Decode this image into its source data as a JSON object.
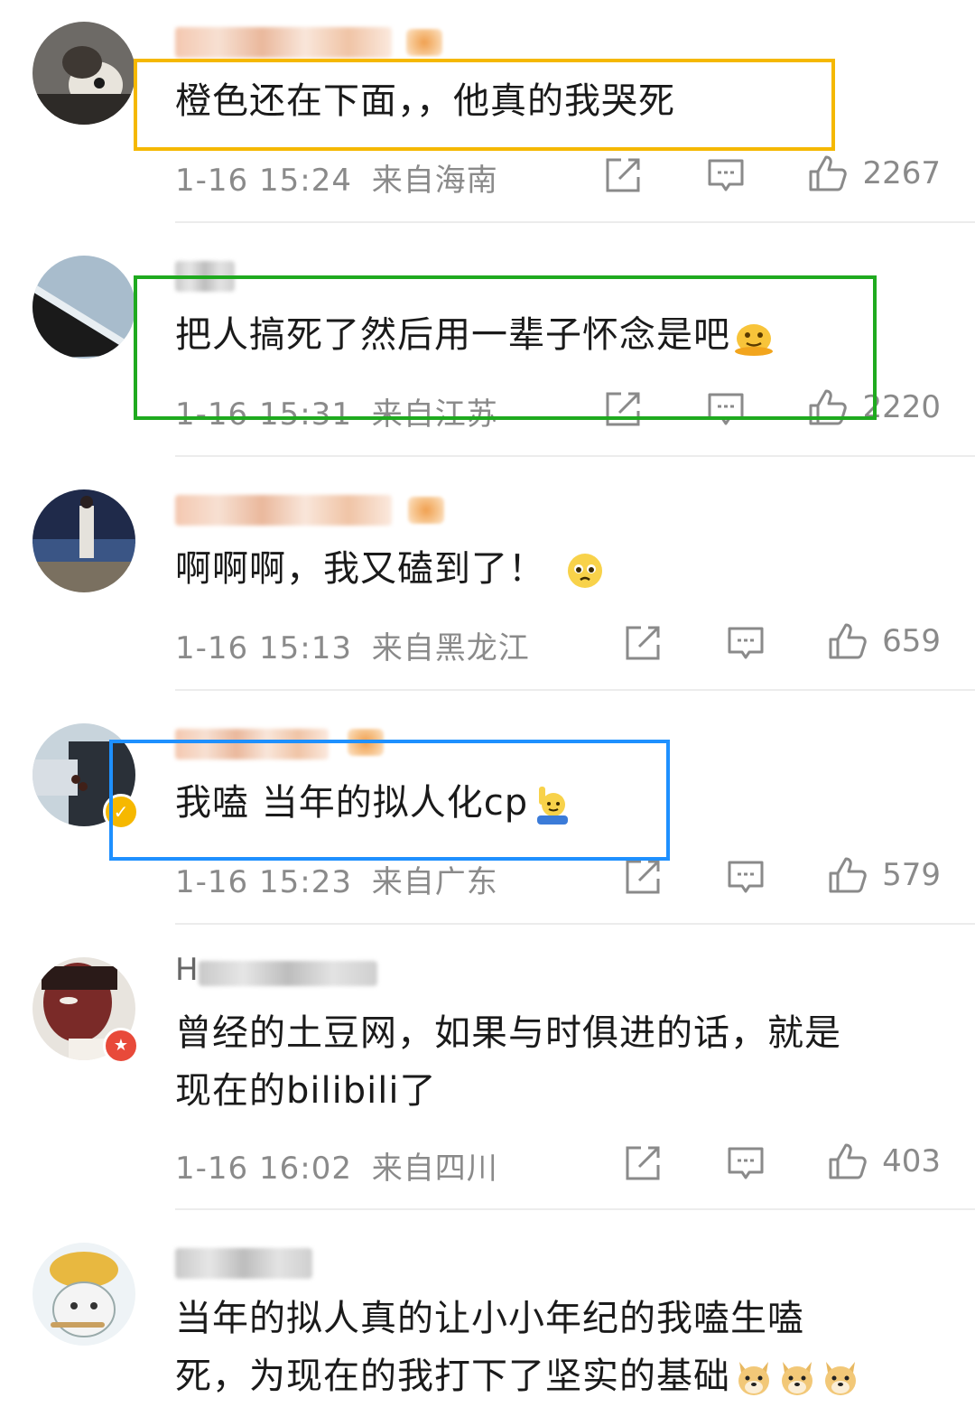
{
  "colors": {
    "highlight_orange": "#f5b800",
    "highlight_green": "#1faa1f",
    "highlight_blue": "#1e90ff",
    "meta_grey": "#8a8a8a"
  },
  "comments": [
    {
      "text_lines": [
        "橙色还在下面，，他真的我哭死"
      ],
      "time": "1-16 15:24",
      "location": "来自海南",
      "likes": "2267",
      "emojis": []
    },
    {
      "text_lines": [
        "把人搞死了然后用一辈子怀念是吧"
      ],
      "time": "1-16 15:31",
      "location": "来自江苏",
      "likes": "2220",
      "emojis": [
        "melting-face-emoji"
      ]
    },
    {
      "text_lines": [
        "啊啊啊，我又磕到了！"
      ],
      "time": "1-16 15:13",
      "location": "来自黑龙江",
      "likes": "659",
      "emojis": [
        "pleading-face-emoji"
      ]
    },
    {
      "text_lines": [
        "我嗑 当年的拟人化cp"
      ],
      "time": "1-16 15:23",
      "location": "来自广东",
      "likes": "579",
      "emojis": [
        "raising-hand-emoji"
      ]
    },
    {
      "username_visible": "H",
      "text_lines": [
        "曾经的土豆网，如果与时俱进的话，就是",
        "现在的bilibili了"
      ],
      "time": "1-16 16:02",
      "location": "来自四川",
      "likes": "403",
      "emojis": []
    },
    {
      "text_lines": [
        "当年的拟人真的让小小年纪的我嗑生嗑",
        "死，为现在的我打下了坚实的基础"
      ],
      "emojis": [
        "doge-emoji",
        "doge-emoji",
        "doge-emoji"
      ]
    }
  ],
  "icons": {
    "share": "share-icon",
    "comment": "comment-icon",
    "like": "thumbs-up-icon"
  }
}
